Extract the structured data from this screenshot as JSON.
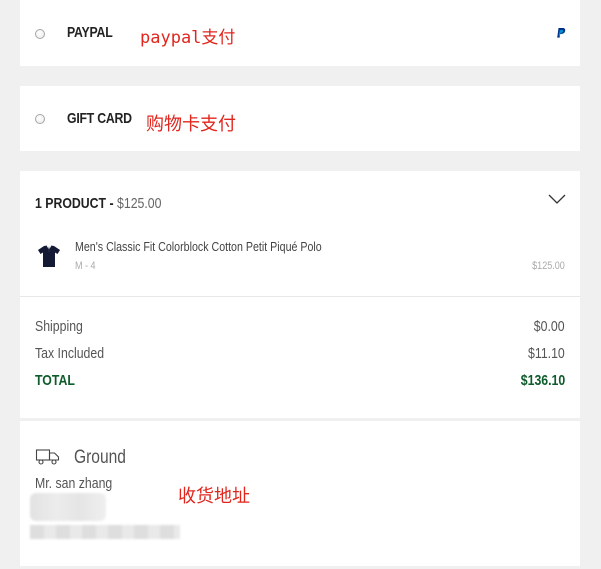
{
  "payment": {
    "paypal": {
      "label": "PAYPAL",
      "annotation": "paypal支付"
    },
    "gift_card": {
      "label": "GIFT CARD",
      "annotation": "购物卡支付"
    }
  },
  "summary": {
    "count_label": "1 PRODUCT -",
    "subtotal": "$125.00",
    "product": {
      "name": "Men's Classic Fit Colorblock Cotton Petit Piqué Polo",
      "variant": "M - 4",
      "price": "$125.00"
    },
    "shipping_label": "Shipping",
    "shipping_value": "$0.00",
    "tax_label": "Tax Included",
    "tax_value": "$11.10",
    "total_label": "TOTAL",
    "total_value": "$136.10"
  },
  "shipping": {
    "method": "Ground",
    "recipient": "Mr. san zhang",
    "annotation": "收货地址"
  },
  "colors": {
    "background": "#f0f0f0",
    "card": "#ffffff",
    "total_green": "#0e5b2b",
    "annotation_red": "#e0261d",
    "paypal_blue": "#003087"
  },
  "icons": [
    "radio-button",
    "paypal-logo-icon",
    "chevron-down-icon",
    "polo-shirt-thumbnail",
    "truck-icon"
  ]
}
